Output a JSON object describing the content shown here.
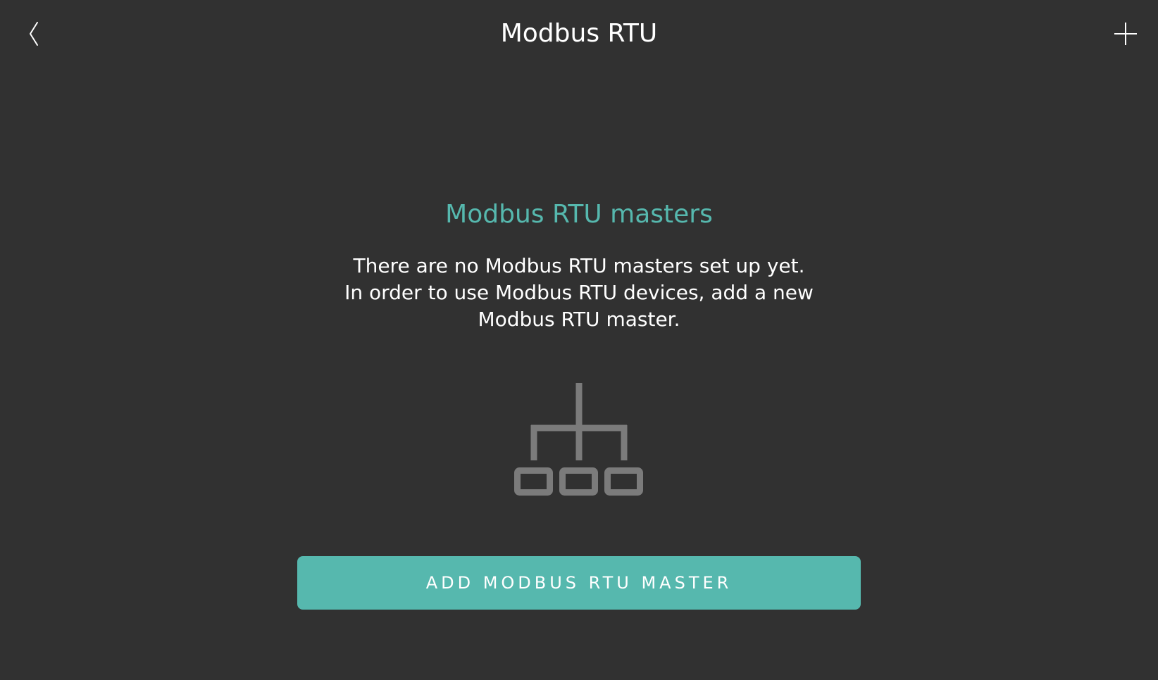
{
  "header": {
    "title": "Modbus RTU",
    "back_icon": "chevron-left-icon",
    "add_icon": "plus-icon"
  },
  "empty_state": {
    "title": "Modbus RTU masters",
    "description_lines": [
      "There are no Modbus RTU masters set up yet.",
      "In order to use Modbus RTU devices, add a new",
      "Modbus RTU master."
    ],
    "illustration_icon": "network-hierarchy-icon",
    "button_label": "ADD MODBUS RTU MASTER"
  },
  "colors": {
    "background": "#313131",
    "accent": "#56b8ae",
    "icon_gray": "#7b7b7b",
    "text": "#ffffff"
  }
}
